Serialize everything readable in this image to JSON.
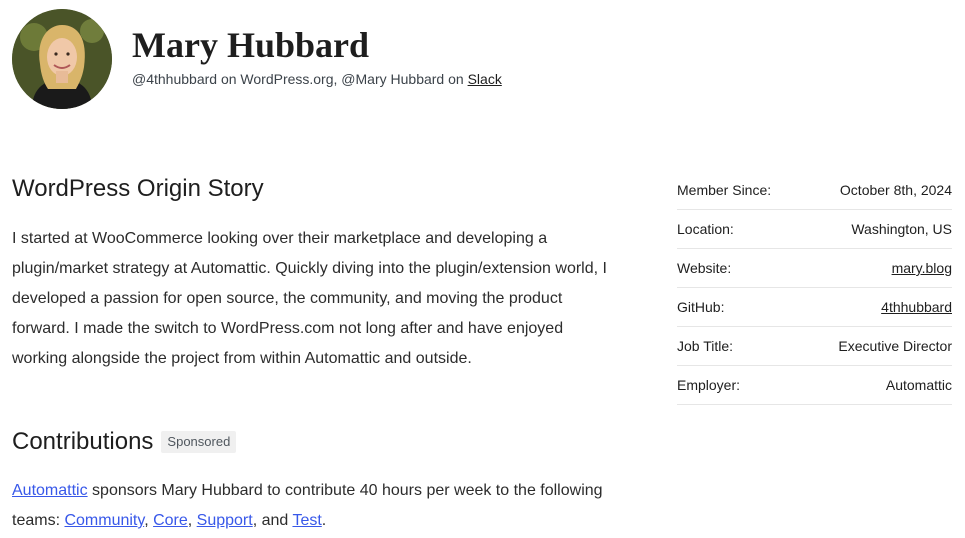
{
  "profile": {
    "name": "Mary Hubbard",
    "handle_org": "@4thhubbard on WordPress.org,",
    "handle_slack_prefix": "@Mary Hubbard on",
    "slack_link": "Slack"
  },
  "origin": {
    "heading": "WordPress Origin Story",
    "body": "I started at WooCommerce looking over their marketplace and developing a plugin/market strategy at Automattic. Quickly diving into the plugin/extension world, I developed a passion for open source, the community, and moving the product forward. I made the switch to WordPress.com not long after and have enjoyed working alongside the project from within Automattic and outside."
  },
  "contributions": {
    "heading": "Contributions",
    "badge": "Sponsored",
    "sponsor_link": "Automattic",
    "text_1": " sponsors Mary Hubbard to contribute 40 hours per week to the following teams: ",
    "teams": [
      "Community",
      "Core",
      "Support",
      "Test"
    ],
    "sep_comma": ", ",
    "sep_and": ", and ",
    "end": "."
  },
  "meta": [
    {
      "label": "Member Since:",
      "value": "October 8th, 2024",
      "link": false
    },
    {
      "label": "Location:",
      "value": "Washington, US",
      "link": false
    },
    {
      "label": "Website:",
      "value": "mary.blog",
      "link": true
    },
    {
      "label": "GitHub:",
      "value": "4thhubbard",
      "link": true
    },
    {
      "label": "Job Title:",
      "value": "Executive Director",
      "link": false
    },
    {
      "label": "Employer:",
      "value": "Automattic",
      "link": false
    }
  ],
  "colors": {
    "link": "#3858e9",
    "text": "#1e1e1e",
    "divider": "#e6e6e6"
  }
}
